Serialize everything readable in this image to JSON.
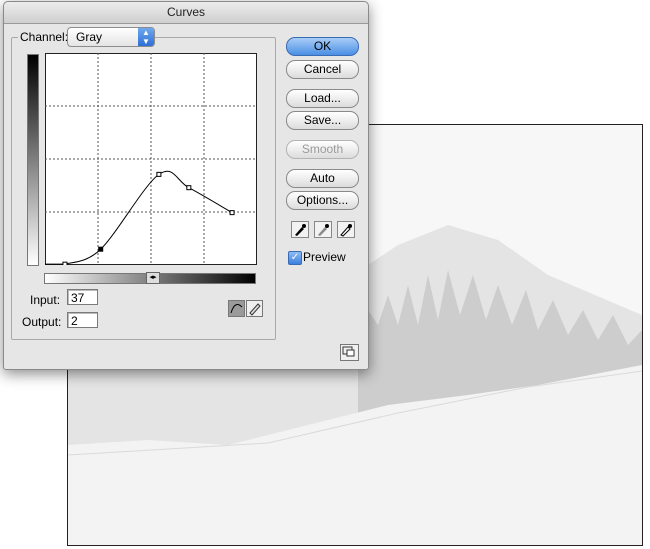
{
  "window": {
    "title": "Curves"
  },
  "channel": {
    "label": "Channel:",
    "value": "Gray"
  },
  "curve": {
    "points": [
      [
        24,
        1
      ],
      [
        67,
        19
      ],
      [
        137,
        109
      ],
      [
        173,
        93
      ],
      [
        225,
        63
      ]
    ],
    "note": "curve control points on 0-255 scale"
  },
  "io": {
    "input_label": "Input:",
    "input_value": "37",
    "output_label": "Output:",
    "output_value": "2"
  },
  "buttons": {
    "ok": "OK",
    "cancel": "Cancel",
    "load": "Load...",
    "save": "Save...",
    "smooth": "Smooth",
    "auto": "Auto",
    "options": "Options..."
  },
  "preview": {
    "label": "Preview",
    "checked": true
  },
  "colors": {
    "accent": "#4b8fe4",
    "dialog_bg": "#e6e6e6"
  }
}
